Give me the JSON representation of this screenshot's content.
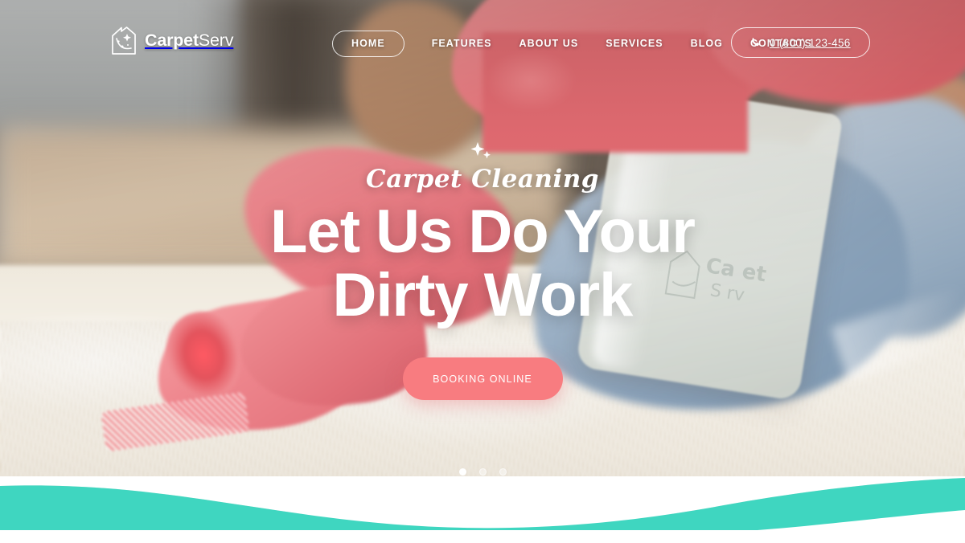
{
  "brand": {
    "name_bold": "Carpet",
    "name_light": "Serv",
    "logo_icon": "house-sparkle-icon"
  },
  "nav": {
    "items": [
      {
        "label": "HOME",
        "active": true
      },
      {
        "label": "FEATURES",
        "active": false
      },
      {
        "label": "ABOUT US",
        "active": false
      },
      {
        "label": "SERVICES",
        "active": false
      },
      {
        "label": "BLOG",
        "active": false
      },
      {
        "label": "CONTACTS",
        "active": false
      }
    ]
  },
  "phone": {
    "icon": "phone-handset-icon",
    "number": "0 (800) 123-456"
  },
  "hero": {
    "sparkle_icon": "sparkle-icon",
    "eyebrow": "Carpet Cleaning",
    "headline_line1": "Let Us Do Your",
    "headline_line2": "Dirty Work",
    "cta_label": "BOOKING ONLINE"
  },
  "slider": {
    "dots": [
      {
        "active": true
      },
      {
        "active": false
      },
      {
        "active": false
      }
    ]
  },
  "colors": {
    "accent_coral": "#f87c80",
    "accent_teal": "#3fd6c0",
    "text_on_hero": "#ffffff",
    "page_background": "#ffffff"
  }
}
